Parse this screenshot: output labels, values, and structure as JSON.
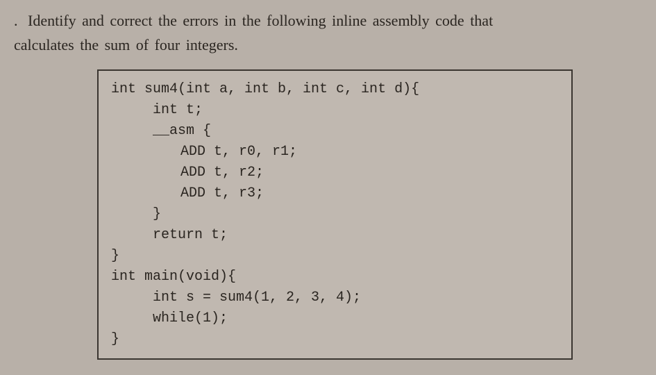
{
  "question": {
    "number": ".",
    "text_line1": "Identify and correct the errors in the following inline assembly code that",
    "text_line2": "calculates the sum of four integers."
  },
  "code": {
    "lines": [
      {
        "indent": 0,
        "text": "int sum4(int a, int b, int c, int d){"
      },
      {
        "indent": 1,
        "text": "int t;"
      },
      {
        "indent": 1,
        "text": "__asm {"
      },
      {
        "indent": 2,
        "text": "ADD t, r0, r1;"
      },
      {
        "indent": 2,
        "text": "ADD t, r2;"
      },
      {
        "indent": 2,
        "text": "ADD t, r3;"
      },
      {
        "indent": 1,
        "text": "}"
      },
      {
        "indent": 1,
        "text": "return t;"
      },
      {
        "indent": 0,
        "text": "}"
      },
      {
        "indent": 0,
        "text": ""
      },
      {
        "indent": 0,
        "text": "int main(void){"
      },
      {
        "indent": 1,
        "text": "int s = sum4(1, 2, 3, 4);"
      },
      {
        "indent": 1,
        "text": "while(1);"
      },
      {
        "indent": 0,
        "text": "}"
      }
    ]
  }
}
